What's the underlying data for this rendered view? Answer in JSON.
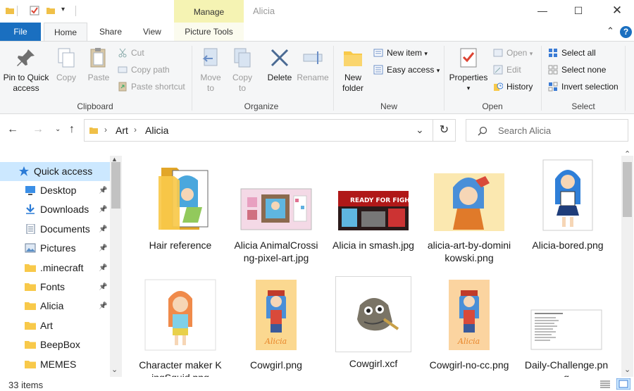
{
  "titlebar": {
    "context_tab": "Manage",
    "window_title": "Alicia",
    "minimize_icon": "minimize-icon",
    "maximize_icon": "maximize-icon",
    "close_icon": "close-icon"
  },
  "tabs": {
    "file": "File",
    "home": "Home",
    "share": "Share",
    "view": "View",
    "picture_tools": "Picture Tools"
  },
  "ribbon": {
    "clipboard": {
      "label": "Clipboard",
      "pin": "Pin to Quick\naccess",
      "copy": "Copy",
      "paste": "Paste",
      "cut": "Cut",
      "copy_path": "Copy path",
      "paste_shortcut": "Paste shortcut"
    },
    "organize": {
      "label": "Organize",
      "move_to": "Move\nto",
      "copy_to": "Copy\nto",
      "delete": "Delete",
      "rename": "Rename"
    },
    "new": {
      "label": "New",
      "new_folder": "New\nfolder",
      "new_item": "New item",
      "easy_access": "Easy access"
    },
    "open": {
      "label": "Open",
      "properties": "Properties",
      "open": "Open",
      "edit": "Edit",
      "history": "History"
    },
    "select": {
      "label": "Select",
      "select_all": "Select all",
      "select_none": "Select none",
      "invert": "Invert selection"
    }
  },
  "address": {
    "crumbs": [
      "Art",
      "Alicia"
    ],
    "search_placeholder": "Search Alicia"
  },
  "nav": {
    "quick_access": "Quick access",
    "items": [
      {
        "label": "Desktop",
        "pinned": true,
        "icon": "desktop-icon"
      },
      {
        "label": "Downloads",
        "pinned": true,
        "icon": "download-icon"
      },
      {
        "label": "Documents",
        "pinned": true,
        "icon": "documents-icon"
      },
      {
        "label": "Pictures",
        "pinned": true,
        "icon": "pictures-icon"
      },
      {
        "label": ".minecraft",
        "pinned": true,
        "icon": "folder-icon"
      },
      {
        "label": "Fonts",
        "pinned": true,
        "icon": "folder-icon"
      },
      {
        "label": "Alicia",
        "pinned": true,
        "icon": "folder-icon"
      },
      {
        "label": "Art",
        "pinned": false,
        "icon": "folder-icon"
      },
      {
        "label": "BeepBox",
        "pinned": false,
        "icon": "folder-icon"
      },
      {
        "label": "MEMES",
        "pinned": false,
        "icon": "folder-icon"
      }
    ]
  },
  "files": [
    {
      "name": "Hair reference",
      "kind": "folder"
    },
    {
      "name": "Alicia AnimalCrossing-pixel-art.jpg",
      "kind": "image"
    },
    {
      "name": "Alicia in smash.jpg",
      "kind": "image"
    },
    {
      "name": "alicia-art-by-dominikowski.png",
      "kind": "image"
    },
    {
      "name": "Alicia-bored.png",
      "kind": "image"
    },
    {
      "name": "Character maker KingSquid.png",
      "kind": "image"
    },
    {
      "name": "Cowgirl.png",
      "kind": "image"
    },
    {
      "name": "Cowgirl.xcf",
      "kind": "gimp"
    },
    {
      "name": "Cowgirl-no-cc.png",
      "kind": "image"
    },
    {
      "name": "Daily-Challenge.png",
      "kind": "image"
    }
  ],
  "thumb_text": {
    "smash": "READY FOR FIGHT!",
    "cowgirl_sig": "Alicia"
  },
  "status": {
    "item_count": "33 items"
  },
  "colors": {
    "accent": "#1a6fc0",
    "selected_nav": "#cce8ff",
    "manage_tab": "#f5f3b3",
    "folder": "#f8c94a"
  }
}
